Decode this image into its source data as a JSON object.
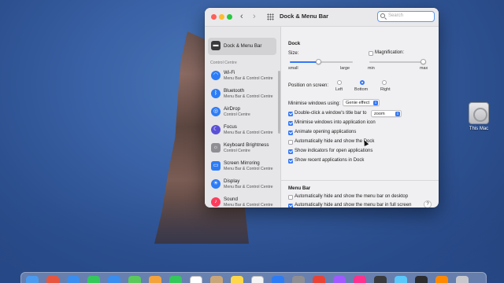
{
  "window": {
    "title": "Dock & Menu Bar",
    "search_placeholder": "Search"
  },
  "desktop": {
    "icon_label": "This Mac"
  },
  "sidebar": {
    "section_header": "Control Centre",
    "items": [
      {
        "name": "Dock & Menu Bar",
        "sub": "",
        "icon": "dock-icon",
        "color": "#3a3a3c"
      },
      {
        "name": "Wi-Fi",
        "sub": "Menu Bar & Control Centre",
        "icon": "wifi-icon",
        "color": "#2d7cf6"
      },
      {
        "name": "Bluetooth",
        "sub": "Menu Bar & Control Centre",
        "icon": "bluetooth-icon",
        "color": "#2d7cf6"
      },
      {
        "name": "AirDrop",
        "sub": "Control Centre",
        "icon": "airdrop-icon",
        "color": "#2d7cf6"
      },
      {
        "name": "Focus",
        "sub": "Menu Bar & Control Centre",
        "icon": "moon-icon",
        "color": "#5b4fd6"
      },
      {
        "name": "Keyboard Brightness",
        "sub": "Control Centre",
        "icon": "keyboard-brightness-icon",
        "color": "#8e8e93"
      },
      {
        "name": "Screen Mirroring",
        "sub": "Menu Bar & Control Centre",
        "icon": "screen-mirroring-icon",
        "color": "#2d7cf6"
      },
      {
        "name": "Display",
        "sub": "Menu Bar & Control Centre",
        "icon": "display-icon",
        "color": "#2d7cf6"
      },
      {
        "name": "Sound",
        "sub": "Menu Bar & Control Centre",
        "icon": "speaker-icon",
        "color": "#ff3b5c"
      }
    ]
  },
  "dock_section": {
    "title": "Dock",
    "size_label": "Size:",
    "size_min": "small",
    "size_max": "large",
    "size_value": 0.45,
    "magnification_label": "Magnification:",
    "mag_min": "min",
    "mag_max": "max",
    "mag_value": 0.98,
    "position_label": "Position on screen:",
    "positions": [
      "Left",
      "Bottom",
      "Right"
    ],
    "selected_position": "Bottom",
    "minimise_label": "Minimise windows using:",
    "minimise_value": "Genie effect",
    "double_click_label": "Double-click a window's title bar to",
    "double_click_value": "zoom",
    "checkboxes": [
      {
        "label": "Minimise windows into application icon",
        "checked": true
      },
      {
        "label": "Animate opening applications",
        "checked": true
      },
      {
        "label": "Automatically hide and show the Dock",
        "checked": false
      },
      {
        "label": "Show indicators for open applications",
        "checked": true
      },
      {
        "label": "Show recent applications in Dock",
        "checked": true
      }
    ]
  },
  "menubar_section": {
    "title": "Menu Bar",
    "checkboxes": [
      {
        "label": "Automatically hide and show the menu bar on desktop",
        "checked": false
      },
      {
        "label": "Automatically hide and show the menu bar in full screen",
        "checked": true
      }
    ],
    "help": "?"
  },
  "dock_bar": {
    "icons": [
      {
        "name": "finder-icon",
        "color": "#4a9bf0"
      },
      {
        "name": "launchpad-icon",
        "color": "#e8553f"
      },
      {
        "name": "safari-icon",
        "color": "#3a8ef0"
      },
      {
        "name": "messages-icon",
        "color": "#34c759"
      },
      {
        "name": "mail-icon",
        "color": "#3a8ef0"
      },
      {
        "name": "maps-icon",
        "color": "#5ac85a"
      },
      {
        "name": "photos-icon",
        "color": "#f4a23a"
      },
      {
        "name": "facetime-icon",
        "color": "#34c759"
      },
      {
        "name": "calendar-icon",
        "color": "#ffffff"
      },
      {
        "name": "contacts-icon",
        "color": "#c9a67a"
      },
      {
        "name": "notes-icon",
        "color": "#ffd84a"
      },
      {
        "name": "freeform-icon",
        "color": "#f5f5f5"
      },
      {
        "name": "appstore-icon",
        "color": "#2d7cf6"
      },
      {
        "name": "system-preferences-icon",
        "color": "#8e8e93"
      },
      {
        "name": "chrome-icon",
        "color": "#e94235"
      },
      {
        "name": "figma-icon",
        "color": "#a259ff"
      },
      {
        "name": "intellij-icon",
        "color": "#ff318c"
      },
      {
        "name": "quicktime-icon",
        "color": "#3a3a3c"
      },
      {
        "name": "preview-icon",
        "color": "#5ac8fa"
      },
      {
        "name": "activity-monitor-icon",
        "color": "#2c2c2e"
      },
      {
        "name": "vlc-icon",
        "color": "#ff8800"
      },
      {
        "name": "trash-icon",
        "color": "#c8c8cc"
      }
    ]
  },
  "accent_color": "#3478f6"
}
